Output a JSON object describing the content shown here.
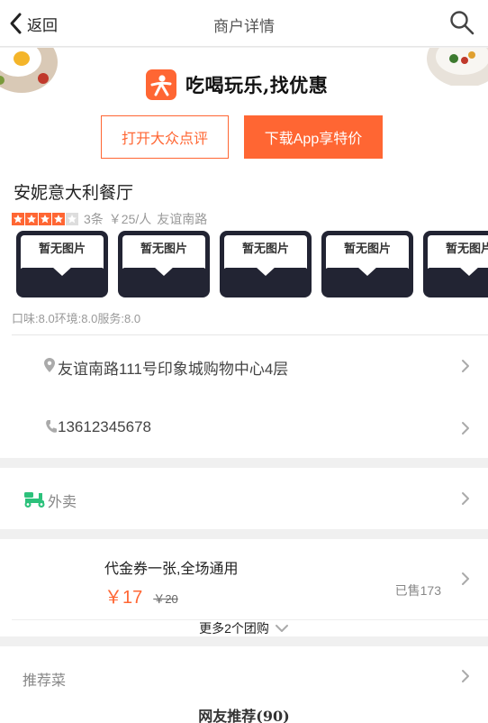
{
  "header": {
    "back_label": "返回",
    "title": "商户详情",
    "search_icon": "search-icon",
    "back_icon": "chevron-left-icon"
  },
  "banner": {
    "slogan": "吃喝玩乐,找优惠",
    "open_button": "打开大众点评",
    "download_button": "下载App享特价",
    "logo_icon": "dianping-logo-icon",
    "accent_color": "#ff6633"
  },
  "shop": {
    "name": "安妮意大利餐厅",
    "rating_stars": 4,
    "rating_max": 5,
    "review_count": "3条",
    "price": "￥25/人",
    "area": "友谊南路",
    "photos": [
      {
        "label": "暂无图片"
      },
      {
        "label": "暂无图片"
      },
      {
        "label": "暂无图片"
      },
      {
        "label": "暂无图片"
      },
      {
        "label": "暂无图片"
      }
    ],
    "scores": "口味:8.0环境:8.0服务:8.0",
    "address": "友谊南路111号印象城购物中心4层",
    "phone": "13612345678"
  },
  "takeout": {
    "label": "外卖",
    "icon": "delivery-scooter-icon"
  },
  "deal": {
    "title": "代金券一张,全场通用",
    "price_now": "￥17",
    "price_old": "￥20",
    "sold": "已售173",
    "more_label": "更多2个团购"
  },
  "recommend": {
    "label": "推荐菜",
    "net_label": "网友推荐(90)"
  }
}
